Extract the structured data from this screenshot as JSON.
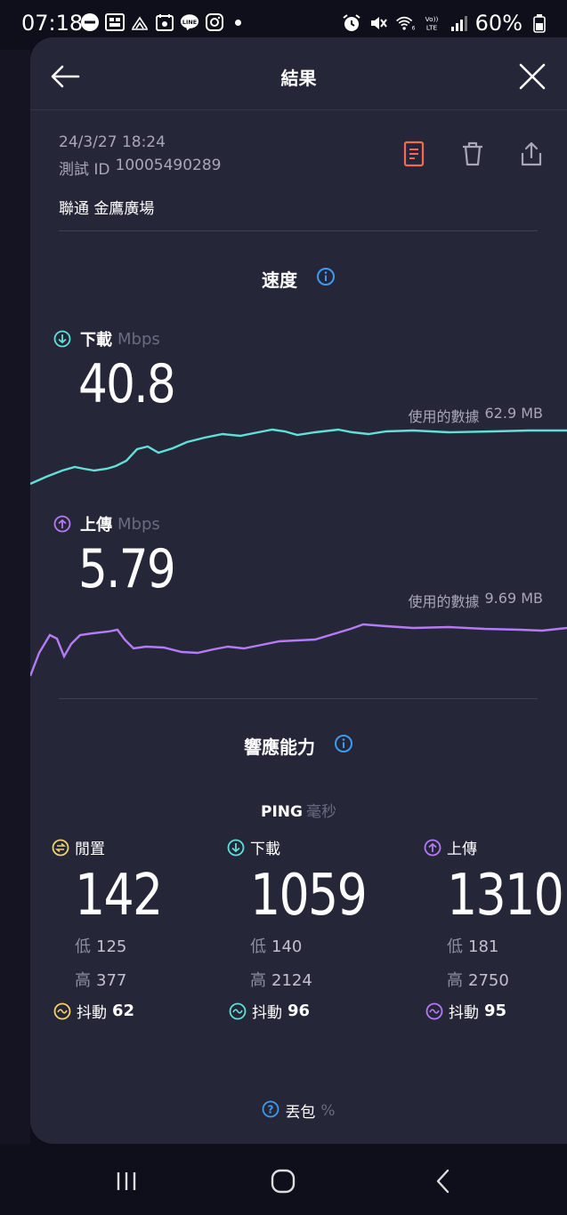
{
  "status_bar": {
    "time": "07:18",
    "battery": "60%",
    "left_icons": [
      "do-not-disturb-icon",
      "mms-icon",
      "network-icon",
      "calendar-icon",
      "line-app-icon",
      "instagram-icon"
    ],
    "right_icons": [
      "alarm-icon",
      "mute-icon",
      "wifi-icon",
      "volte-icon",
      "signal-icon",
      "battery-icon"
    ]
  },
  "header": {
    "title": "結果"
  },
  "result": {
    "date": "24/3/27 18:24",
    "test_id_label": "測試 ID",
    "test_id": "10005490289",
    "provider": "聯通 金鷹廣場"
  },
  "speed": {
    "title": "速度",
    "download": {
      "label": "下載",
      "unit": "Mbps",
      "value": "40.8",
      "data_used_label": "使用的數據",
      "data_used": "62.9 MB",
      "color": "#5fe0d9"
    },
    "upload": {
      "label": "上傳",
      "unit": "Mbps",
      "value": "5.79",
      "data_used_label": "使用的數據",
      "data_used": "9.69 MB",
      "color": "#b57bf5"
    }
  },
  "responsiveness": {
    "title": "響應能力",
    "ping_label": "PING",
    "ping_unit": "毫秒",
    "low_label": "低",
    "high_label": "高",
    "jitter_label": "抖動",
    "columns": [
      {
        "label": "閒置",
        "value": "142",
        "low": "125",
        "high": "377",
        "jitter": "62",
        "color": "#f2d36a"
      },
      {
        "label": "下載",
        "value": "1059",
        "low": "140",
        "high": "2124",
        "jitter": "96",
        "color": "#5fe0d9"
      },
      {
        "label": "上傳",
        "value": "1310",
        "low": "181",
        "high": "2750",
        "jitter": "95",
        "color": "#b57bf5"
      }
    ]
  },
  "packet_loss": {
    "label": "丟包",
    "unit": "%"
  },
  "nav": {
    "items": [
      "recent-apps-icon",
      "home-icon",
      "back-icon"
    ]
  }
}
